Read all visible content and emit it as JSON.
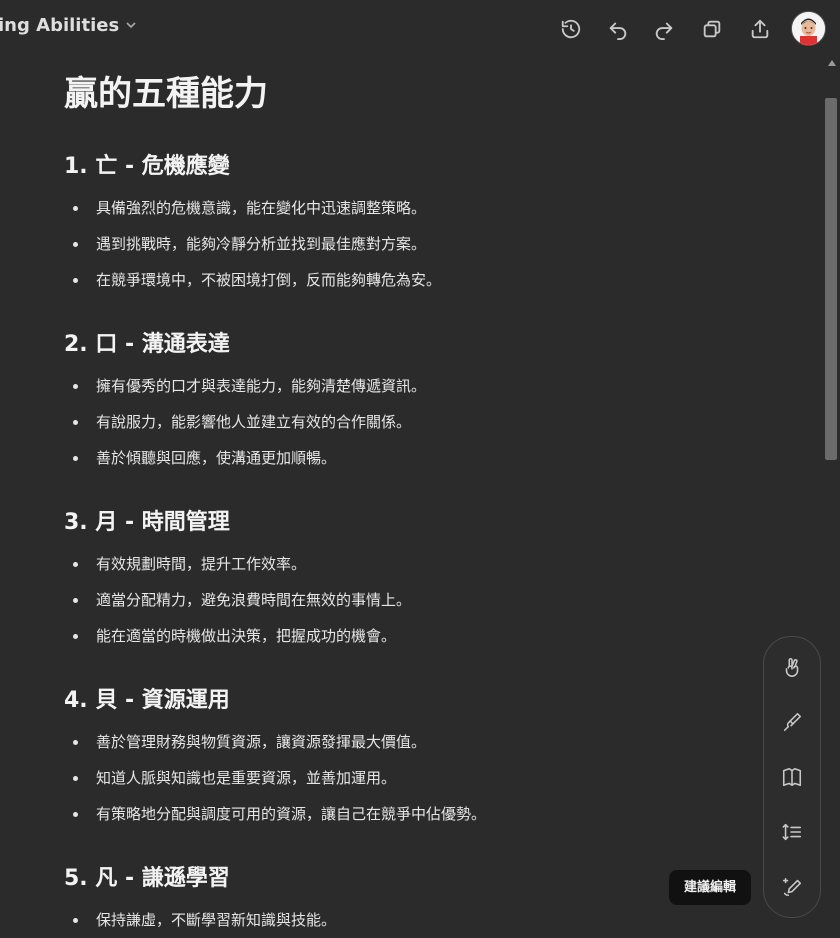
{
  "header": {
    "title": "ing Abilities",
    "icons": [
      "history-icon",
      "undo-icon",
      "redo-icon",
      "copy-icon",
      "share-icon"
    ]
  },
  "document": {
    "title": "贏的五種能力",
    "sections": [
      {
        "heading": "1. 亡 - 危機應變",
        "items": [
          "具備強烈的危機意識，能在變化中迅速調整策略。",
          "遇到挑戰時，能夠冷靜分析並找到最佳應對方案。",
          "在競爭環境中，不被困境打倒，反而能夠轉危為安。"
        ]
      },
      {
        "heading": "2. 口 - 溝通表達",
        "items": [
          "擁有優秀的口才與表達能力，能夠清楚傳遞資訊。",
          "有說服力，能影響他人並建立有效的合作關係。",
          "善於傾聽與回應，使溝通更加順暢。"
        ]
      },
      {
        "heading": "3. 月 - 時間管理",
        "items": [
          "有效規劃時間，提升工作效率。",
          "適當分配精力，避免浪費時間在無效的事情上。",
          "能在適當的時機做出決策，把握成功的機會。"
        ]
      },
      {
        "heading": "4. 貝 - 資源運用",
        "items": [
          "善於管理財務與物質資源，讓資源發揮最大價值。",
          "知道人脈與知識也是重要資源，並善加運用。",
          "有策略地分配與調度可用的資源，讓自己在競爭中佔優勢。"
        ]
      },
      {
        "heading": "5. 凡 - 謙遜學習",
        "items": [
          "保持謙虛，不斷學習新知識與技能。"
        ]
      }
    ]
  },
  "toolbox": {
    "tools": [
      "peace-hand-icon",
      "paintbrush-icon",
      "book-icon",
      "line-height-icon",
      "suggest-edit-icon"
    ],
    "tooltip": "建議編輯"
  }
}
